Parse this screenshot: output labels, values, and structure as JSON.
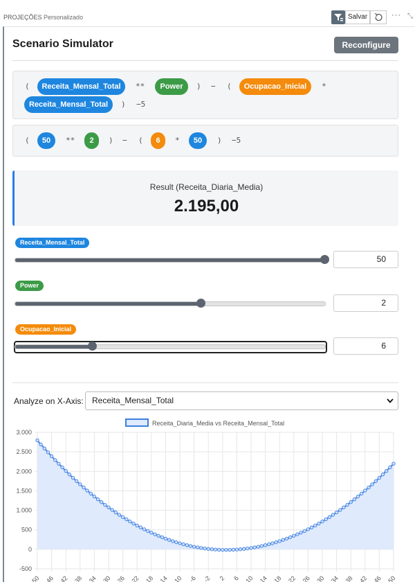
{
  "header": {
    "breadcrumb_main": "PROJEÇÕES",
    "breadcrumb_sub": "Personalizado",
    "save_label": "Salvar",
    "more_label": "···"
  },
  "simulator": {
    "title": "Scenario Simulator",
    "reconfigure_label": "Reconfigure",
    "formula_symbolic": {
      "open1": "(",
      "var1": "Receita_Mensal_Total",
      "op_pow": "**",
      "var2": "Power",
      "close1": ")",
      "minus": "−",
      "open2": "(",
      "var3": "Ocupacao_Inicial",
      "op_mul": "*",
      "var4": "Receita_Mensal_Total",
      "close2": ")",
      "const": "−5"
    },
    "formula_numeric": {
      "open1": "(",
      "v1": "50",
      "op_pow": "**",
      "v2": "2",
      "close1": ")",
      "minus": "−",
      "open2": "(",
      "v3": "6",
      "op_mul": "*",
      "v4": "50",
      "close2": ")",
      "const": "−5"
    },
    "result": {
      "label": "Result (Receita_Diaria_Media)",
      "value": "2.195,00"
    },
    "variables": [
      {
        "name": "Receita_Mensal_Total",
        "value": "50",
        "level": 1.0,
        "color": "#1e86df"
      },
      {
        "name": "Power",
        "value": "2",
        "level": 0.6,
        "color": "#3c9b46"
      },
      {
        "name": "Ocupacao_Inicial",
        "value": "6",
        "level": 0.25,
        "color": "#f48b0c"
      }
    ],
    "analyze": {
      "label": "Analyze on X-Axis:",
      "selected": "Receita_Mensal_Total"
    }
  },
  "chart_data": {
    "type": "area",
    "legend": "Receita_Diaria_Media vs Receita_Mensal_Total",
    "legend_position": "top",
    "x_range": [
      -50,
      50
    ],
    "x_step": 1,
    "formula": "y = x**2 - 6*x - 5",
    "ylim": [
      -500,
      3000
    ],
    "y_ticks": [
      "3.000",
      "2.500",
      "2.000",
      "1.500",
      "1.000",
      "500",
      "0",
      "-500"
    ],
    "x_ticks": [
      "-50",
      "-46",
      "-42",
      "-38",
      "-34",
      "-30",
      "-26",
      "-22",
      "-18",
      "-14",
      "-10",
      "-6",
      "-2",
      "2",
      "6",
      "10",
      "14",
      "18",
      "22",
      "26",
      "30",
      "34",
      "38",
      "42",
      "46",
      "50"
    ],
    "line_color": "#3d7fe0",
    "fill_color": "#dfeafc",
    "grid": true
  }
}
